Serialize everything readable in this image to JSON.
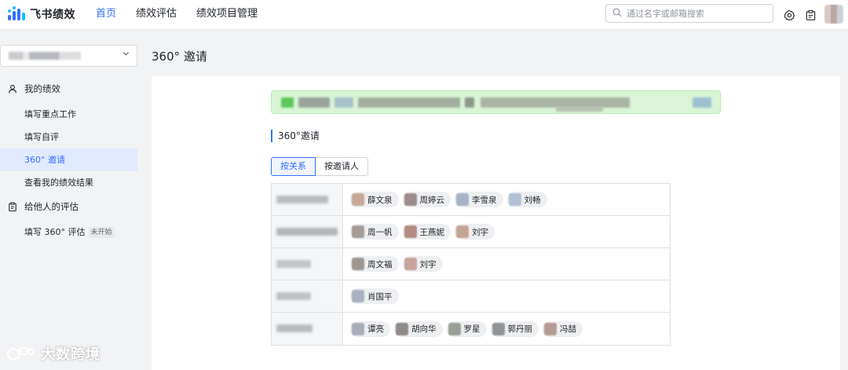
{
  "app": {
    "name": "飞书绩效"
  },
  "topnav": {
    "items": [
      "首页",
      "绩效评估",
      "绩效项目管理"
    ],
    "active_index": 0
  },
  "search": {
    "placeholder": "通过名字或邮箱搜索"
  },
  "icons": [
    "search-icon",
    "settings-icon",
    "clipboard-icon"
  ],
  "sidebar": {
    "groups": [
      {
        "label": "我的绩效",
        "icon": "user-icon",
        "items": [
          {
            "label": "填写重点工作"
          },
          {
            "label": "填写自评"
          },
          {
            "label": "360° 邀请",
            "active": true
          },
          {
            "label": "查看我的绩效结果"
          }
        ]
      },
      {
        "label": "给他人的评估",
        "icon": "clipboard-icon",
        "items": [
          {
            "label": "填写 360° 评估",
            "badge": "未开始"
          }
        ]
      }
    ]
  },
  "main": {
    "title": "360° 邀请",
    "section_title": "360°邀请",
    "tabs": [
      "按关系",
      "按邀请人"
    ],
    "active_tab": 0,
    "rows": [
      {
        "people": [
          "薛文泉",
          "周婷云",
          "李雪泉",
          "刘畅"
        ]
      },
      {
        "people": [
          "周一帆",
          "王燕妮",
          "刘宇"
        ]
      },
      {
        "people": [
          "周文福",
          "刘宇"
        ]
      },
      {
        "people": [
          "肖国平"
        ]
      },
      {
        "people": [
          "谭亮",
          "胡向华",
          "罗星",
          "郭丹丽",
          "冯喆"
        ]
      }
    ]
  },
  "watermark": {
    "text": "大数跨境"
  },
  "colors": {
    "accent": "#3370ff",
    "notice_bg": "#d9f5d6",
    "active_bg": "#e1eaff"
  }
}
